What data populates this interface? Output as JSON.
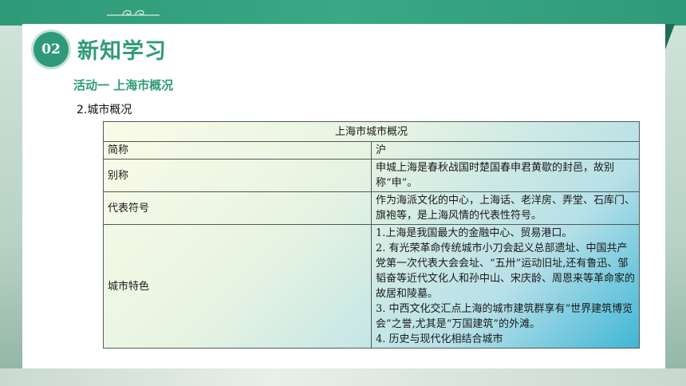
{
  "section": {
    "number": "02",
    "title": "新知学习"
  },
  "activity": {
    "title": "活动一  上海市概况"
  },
  "subheading": "2.城市概况",
  "table": {
    "header": "上海市城市概况",
    "rows": [
      {
        "label": "简称",
        "content": "沪"
      },
      {
        "label": "别称",
        "content": "申城上海是春秋战国时楚国春申君黄歇的封邑，故别称“申”。"
      },
      {
        "label": "代表符号",
        "content": "作为海派文化的中心，上海话、老洋房、弄堂、石库门、旗袍等，是上海风情的代表性符号。"
      }
    ],
    "features": {
      "label": "城市特色",
      "lines": [
        "1.上海是我国最大的金融中心、贸易港口。",
        "2. 有光荣革命传统城市小刀会起义总部遗址、中国共产党第一次代表大会会址、“五卅”运动旧址,还有鲁迅、邹韬奋等近代文化人和孙中山、宋庆龄、周恩来等革命家的故居和陵墓。",
        "3.  中西文化交汇点上海的城市建筑群享有“世界建筑博览会”之誉,尤其是“万国建筑”的外滩。",
        "4.  历史与现代化相结合城市"
      ]
    }
  },
  "colors": {
    "accent": "#2f9a79",
    "banner": "#3aa884"
  },
  "icons": {
    "ornament": "cloud-ornament-icon"
  }
}
